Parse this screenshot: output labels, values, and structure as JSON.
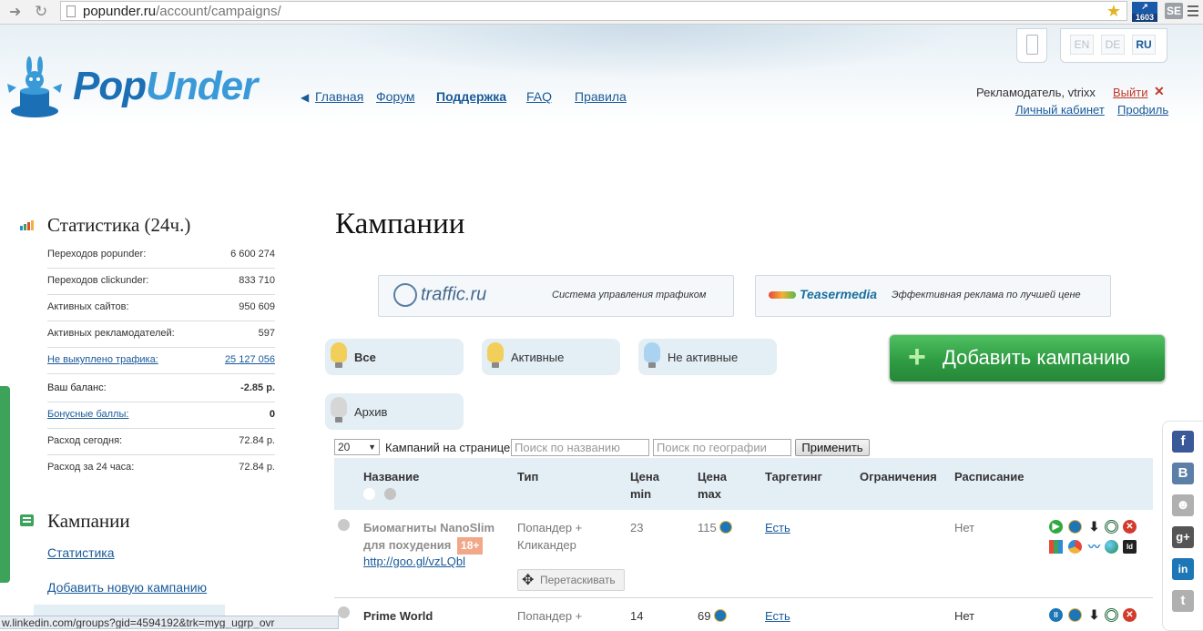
{
  "browser": {
    "url_host": "popunder.ru",
    "url_path": "/account/campaigns/",
    "ext_badge": "1603",
    "ext2_label": "SE",
    "status_link": "w.linkedin.com/groups?gid=4594192&trk=myg_ugrp_ovr"
  },
  "header": {
    "logo_text_a": "Pop",
    "logo_text_b": "Under",
    "nav": [
      {
        "label": "Главная"
      },
      {
        "label": "Форум"
      },
      {
        "label": "Поддержка"
      },
      {
        "label": "FAQ"
      },
      {
        "label": "Правила"
      }
    ],
    "languages": [
      {
        "code": "EN",
        "active": false
      },
      {
        "code": "DE",
        "active": false
      },
      {
        "code": "RU",
        "active": true
      }
    ],
    "user_line": "Рекламодатель, vtrixx",
    "logout": "Выйти",
    "cabinet": "Личный кабинет",
    "profile": "Профиль"
  },
  "sidebar": {
    "stats_title": "Статистика (24ч.)",
    "stats": [
      {
        "label": "Переходов popunder:",
        "value": "6 600 274"
      },
      {
        "label": "Переходов clickunder:",
        "value": "833 710"
      },
      {
        "label": "Активных сайтов:",
        "value": "950 609"
      },
      {
        "label": "Активных рекламодателей:",
        "value": "597"
      },
      {
        "label": "Не выкуплено трафика:",
        "value": "25 127 056"
      },
      {
        "label": "Ваш баланс:",
        "value": "-2.85 р."
      },
      {
        "label": "Бонусные баллы:",
        "value": "0"
      },
      {
        "label": "Расход сегодня:",
        "value": "72.84 р."
      },
      {
        "label": "Расход за 24 часа:",
        "value": "72.84 р."
      }
    ],
    "campaigns_title": "Кампании",
    "links": [
      {
        "label": "Статистика"
      },
      {
        "label": "Добавить новую кампанию"
      }
    ]
  },
  "main": {
    "title": "Кампании",
    "ads": [
      {
        "brand": "traffic.ru",
        "tagline": "Система управления трафиком"
      },
      {
        "brand": "Teasermedia",
        "tagline": "Эффективная реклама по лучшей цене"
      }
    ],
    "filters": [
      {
        "label": "Все",
        "bulb": "#f2cf5a"
      },
      {
        "label": "Активные",
        "bulb": "#f2cf5a"
      },
      {
        "label": "Не активные",
        "bulb": "#a9d3f0"
      },
      {
        "label": "Архив",
        "bulb": "#d6d6d6"
      }
    ],
    "add_button": "Добавить кампанию",
    "per_page_value": "20",
    "per_page_label": "Кампаний на странице",
    "search_name_placeholder": "Поиск по названию",
    "search_geo_placeholder": "Поиск по географии",
    "apply_label": "Применить",
    "columns": [
      "Название",
      "Тип",
      "Цена min",
      "Цена max",
      "Таргетинг",
      "Ограничения",
      "Расписание"
    ],
    "rows": [
      {
        "name": "Биомагниты NanoSlim для похудения",
        "age": "18+",
        "url": "http://goo.gl/vzLQbl",
        "type": "Попандер + Кликандер",
        "price_min": "23",
        "price_max": "115",
        "targeting": "Есть",
        "schedule": "Нет",
        "drag_label": "Перетаскивать"
      },
      {
        "name": "Prime World",
        "type": "Попандер +",
        "price_min": "14",
        "price_max": "69",
        "targeting": "Есть",
        "schedule": "Нет"
      }
    ]
  },
  "social": [
    {
      "name": "facebook",
      "glyph": "f",
      "color": "#3b5998"
    },
    {
      "name": "vkontakte",
      "glyph": "B",
      "color": "#5b7fa6"
    },
    {
      "name": "odnoklassniki",
      "glyph": "☻",
      "color": "#b0b0b0"
    },
    {
      "name": "google-plus",
      "glyph": "g+",
      "color": "#555555"
    },
    {
      "name": "linkedin",
      "glyph": "in",
      "color": "#1d76b5"
    },
    {
      "name": "twitter",
      "glyph": "t",
      "color": "#b0b0b0"
    }
  ]
}
